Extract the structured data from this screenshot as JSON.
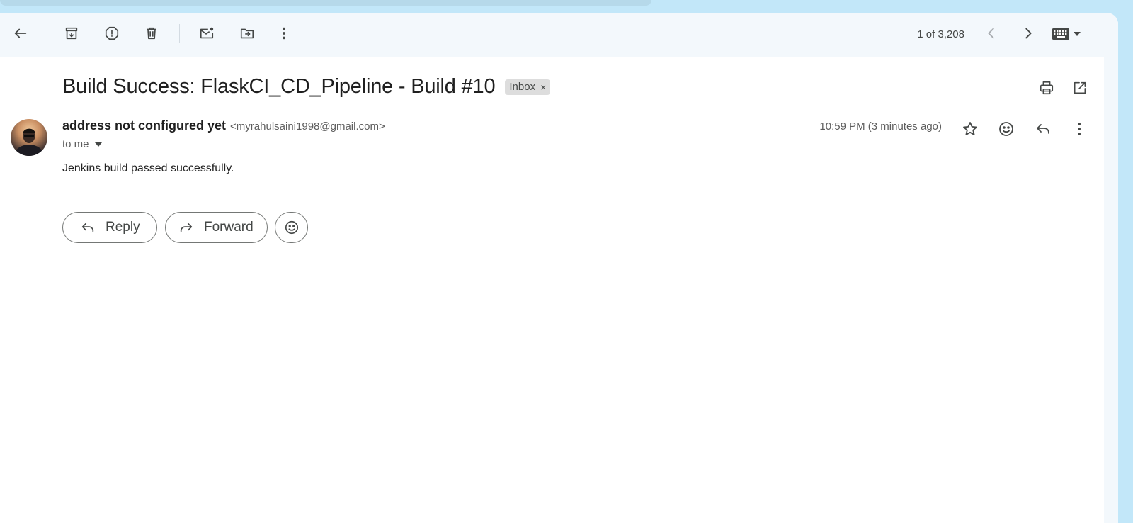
{
  "toolbar": {
    "icons": {
      "back": "arrow-back-icon",
      "archive": "archive-icon",
      "spam": "report-spam-icon",
      "delete": "delete-icon",
      "mark_unread": "mark-unread-icon",
      "move": "move-to-icon",
      "more": "more-vert-icon",
      "prev": "chevron-left-icon",
      "next": "chevron-right-icon",
      "keyboard": "keyboard-icon"
    },
    "page_count": "1 of 3,208"
  },
  "email": {
    "subject": "Build Success: FlaskCI_CD_Pipeline - Build #10",
    "label": "Inbox",
    "label_remove": "×",
    "sender_name": "address not configured yet",
    "sender_email": "<myrahulsaini1998@gmail.com>",
    "to": "to me",
    "timestamp": "10:59 PM (3 minutes ago)",
    "body": "Jenkins build passed successfully."
  },
  "actions": {
    "reply_label": "Reply",
    "forward_label": "Forward"
  },
  "colors": {
    "background": "#c2e7f9",
    "toolbar": "#f3f8fc",
    "chip": "#dddddd",
    "icon": "#444746"
  }
}
